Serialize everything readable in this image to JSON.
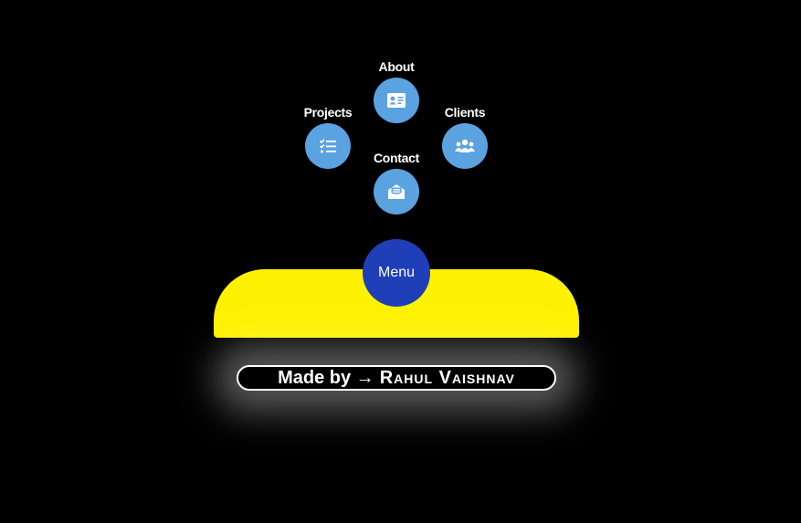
{
  "menu": {
    "items": [
      {
        "label": "About",
        "icon": "id-card-icon"
      },
      {
        "label": "Projects",
        "icon": "checklist-icon"
      },
      {
        "label": "Clients",
        "icon": "users-icon"
      },
      {
        "label": "Contact",
        "icon": "envelope-open-icon"
      }
    ],
    "button_label": "Menu"
  },
  "footer": {
    "prefix": "Made by →",
    "name": "Rahul Vaishnav"
  },
  "colors": {
    "background": "#000000",
    "item": "#5aa3e0",
    "menu_button": "#1f3fb8",
    "tray": "#fff200",
    "text": "#ffffff"
  }
}
